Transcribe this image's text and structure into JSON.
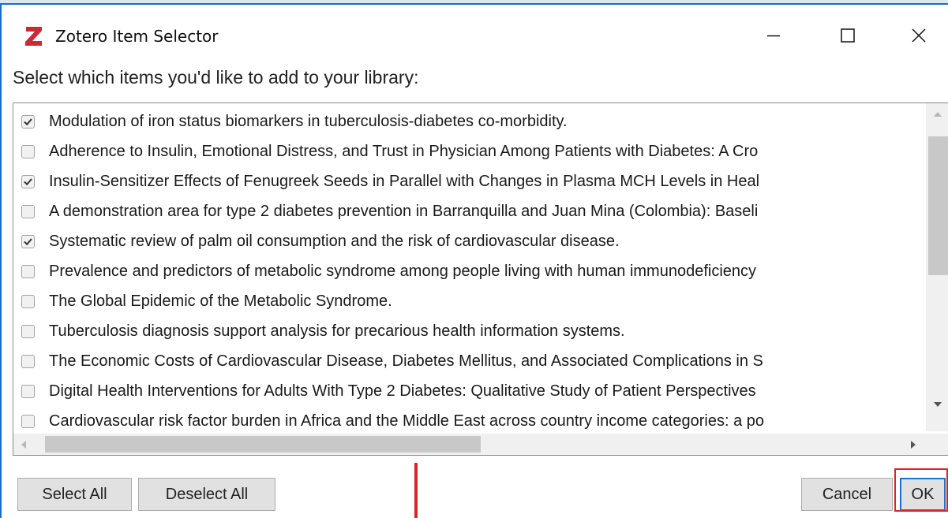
{
  "window": {
    "title": "Zotero Item Selector",
    "icon": "zotero-z-icon",
    "controls": [
      "minimize-icon",
      "maximize-icon",
      "close-icon"
    ]
  },
  "prompt": "Select which items you'd like to add to your library:",
  "items": [
    {
      "label": "Modulation of iron status biomarkers in tuberculosis-diabetes co-morbidity.",
      "checked": true
    },
    {
      "label": "Adherence to Insulin, Emotional Distress, and Trust in Physician Among Patients with Diabetes: A Cro",
      "checked": false
    },
    {
      "label": "Insulin-Sensitizer Effects of Fenugreek Seeds in Parallel with Changes in Plasma MCH Levels in Heal",
      "checked": true
    },
    {
      "label": "A demonstration area for type 2 diabetes prevention in Barranquilla and Juan Mina (Colombia): Baseli",
      "checked": false
    },
    {
      "label": "Systematic review of palm oil consumption and the risk of cardiovascular disease.",
      "checked": true
    },
    {
      "label": "Prevalence and predictors of metabolic syndrome among people living with human immunodeficiency",
      "checked": false
    },
    {
      "label": "The Global Epidemic of the Metabolic Syndrome.",
      "checked": false
    },
    {
      "label": "Tuberculosis diagnosis support analysis for precarious health information systems.",
      "checked": false
    },
    {
      "label": "The Economic Costs of Cardiovascular Disease, Diabetes Mellitus, and Associated Complications in S",
      "checked": false
    },
    {
      "label": "Digital Health Interventions for Adults With Type 2 Diabetes: Qualitative Study of Patient Perspectives",
      "checked": false
    },
    {
      "label": "Cardiovascular risk factor burden in Africa and the Middle East across country income categories: a po",
      "checked": false
    }
  ],
  "buttons": {
    "select_all": "Select All",
    "deselect_all": "Deselect All",
    "cancel": "Cancel",
    "ok": "OK"
  },
  "colors": {
    "window_border": "#1b6fc2",
    "annotation": "#d9242a",
    "zotero_red": "#cc2936",
    "ok_focus": "#1a73c9"
  }
}
